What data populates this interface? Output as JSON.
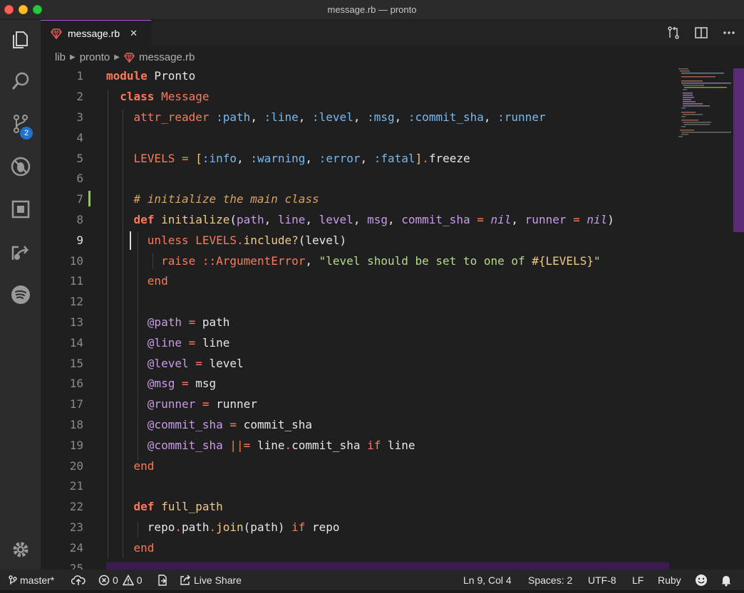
{
  "window": {
    "title": "message.rb — pronto"
  },
  "activity_bar": {
    "items": [
      {
        "name": "explorer",
        "icon": "files-icon"
      },
      {
        "name": "search",
        "icon": "search-icon"
      },
      {
        "name": "source-control",
        "icon": "git-branch-icon",
        "badge": "2"
      },
      {
        "name": "debug",
        "icon": "bug-icon"
      },
      {
        "name": "extensions",
        "icon": "extensions-icon"
      },
      {
        "name": "remote",
        "icon": "remote-icon"
      },
      {
        "name": "spotify",
        "icon": "spotify-icon"
      }
    ],
    "settings_icon": "gear-icon"
  },
  "tab": {
    "label": "message.rb",
    "close": "✕"
  },
  "breadcrumb": {
    "items": [
      "lib",
      "pronto",
      "message.rb"
    ]
  },
  "editor": {
    "active_line": 9,
    "lines": [
      "1",
      "2",
      "3",
      "4",
      "5",
      "6",
      "7",
      "8",
      "9",
      "10",
      "11",
      "12",
      "13",
      "14",
      "15",
      "16",
      "17",
      "18",
      "19",
      "20",
      "21",
      "22",
      "23",
      "24",
      "25"
    ]
  },
  "status_bar": {
    "branch": "master*",
    "errors": "0",
    "warnings": "0",
    "live_share": "Live Share",
    "position": "Ln 9, Col 4",
    "spaces": "Spaces: 2",
    "encoding": "UTF-8",
    "eol": "LF",
    "language": "Ruby"
  },
  "colors": {
    "accent": "#b35ee6",
    "keyword": "#fb7a5a",
    "symbol": "#77b9ee",
    "string": "#b7d98a",
    "comment": "#d9a45a",
    "ivar": "#c99be8",
    "badge": "#1f74c9"
  }
}
